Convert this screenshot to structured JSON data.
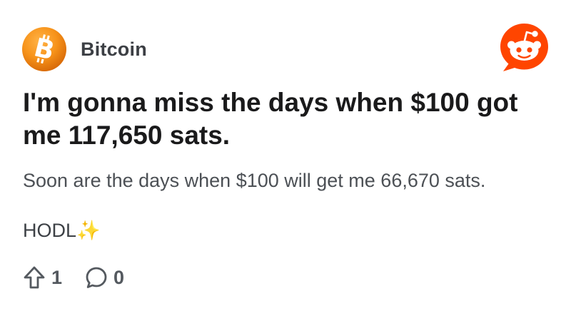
{
  "community": {
    "name": "Bitcoin",
    "avatar_icon": "bitcoin-icon",
    "avatar_color": "#f7931a"
  },
  "brand": {
    "logo_icon": "reddit-icon",
    "color": "#ff4500"
  },
  "post": {
    "title": "I'm gonna miss the days when $100 got me 117,650 sats.",
    "body_line1": "Soon are the days when $100 will get me 66,670 sats.",
    "body_line2": "HODL✨"
  },
  "footer": {
    "upvotes": "1",
    "comments": "0",
    "upvote_icon": "upvote-arrow-icon",
    "comment_icon": "comment-bubble-icon"
  }
}
